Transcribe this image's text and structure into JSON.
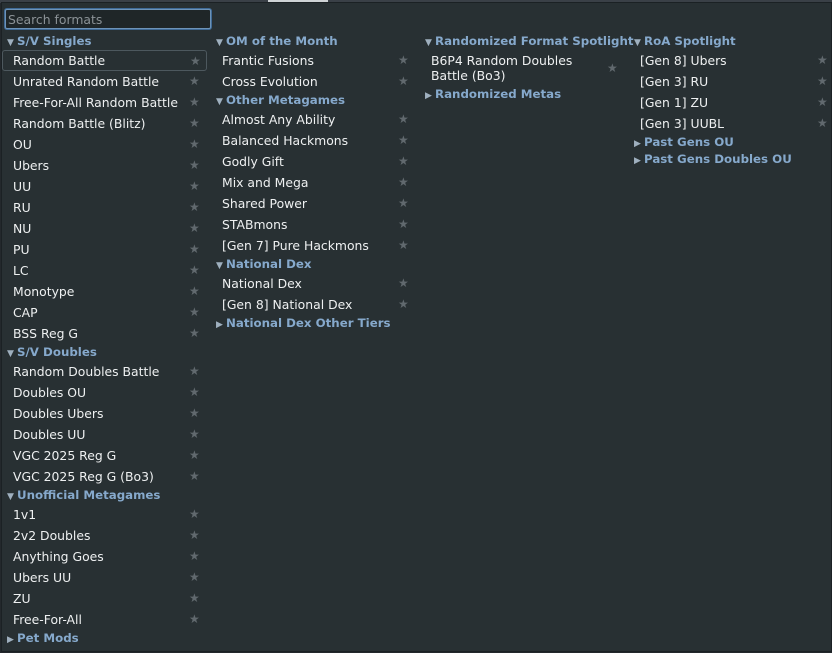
{
  "search": {
    "placeholder": "Search formats",
    "value": ""
  },
  "columns": [
    [
      {
        "header": "S/V Singles",
        "expanded": true,
        "items": [
          "Random Battle",
          "Unrated Random Battle",
          "Free-For-All Random Battle",
          "Random Battle (Blitz)",
          "OU",
          "Ubers",
          "UU",
          "RU",
          "NU",
          "PU",
          "LC",
          "Monotype",
          "CAP",
          "BSS Reg G"
        ],
        "selected": 0
      },
      {
        "header": "S/V Doubles",
        "expanded": true,
        "items": [
          "Random Doubles Battle",
          "Doubles OU",
          "Doubles Ubers",
          "Doubles UU",
          "VGC 2025 Reg G",
          "VGC 2025 Reg G (Bo3)"
        ]
      },
      {
        "header": "Unofficial Metagames",
        "expanded": true,
        "items": [
          "1v1",
          "2v2 Doubles",
          "Anything Goes",
          "Ubers UU",
          "ZU",
          "Free-For-All"
        ]
      },
      {
        "header": "Pet Mods",
        "expanded": false,
        "items": []
      }
    ],
    [
      {
        "header": "OM of the Month",
        "expanded": true,
        "items": [
          "Frantic Fusions",
          "Cross Evolution"
        ]
      },
      {
        "header": "Other Metagames",
        "expanded": true,
        "items": [
          "Almost Any Ability",
          "Balanced Hackmons",
          "Godly Gift",
          "Mix and Mega",
          "Shared Power",
          "STABmons",
          "[Gen 7] Pure Hackmons"
        ]
      },
      {
        "header": "National Dex",
        "expanded": true,
        "items": [
          "National Dex",
          "[Gen 8] National Dex"
        ]
      },
      {
        "header": "National Dex Other Tiers",
        "expanded": false,
        "items": []
      }
    ],
    [
      {
        "header": "Randomized Format Spotlight",
        "expanded": true,
        "items": [
          "B6P4 Random Doubles Battle (Bo3)"
        ]
      },
      {
        "header": "Randomized Metas",
        "expanded": false,
        "items": []
      }
    ],
    [
      {
        "header": "RoA Spotlight",
        "expanded": true,
        "items": [
          "[Gen 8] Ubers",
          "[Gen 3] RU",
          "[Gen 1] ZU",
          "[Gen 3] UUBL"
        ]
      },
      {
        "header": "Past Gens OU",
        "expanded": false,
        "items": []
      },
      {
        "header": "Past Gens Doubles OU",
        "expanded": false,
        "items": []
      }
    ]
  ],
  "icons": {
    "expanded": "▼",
    "collapsed": "▶",
    "favorite": "★"
  },
  "colors": {
    "header": "#86a9cc",
    "panel": "#283033",
    "star": "#61696e",
    "focus": "#6d93b8"
  }
}
